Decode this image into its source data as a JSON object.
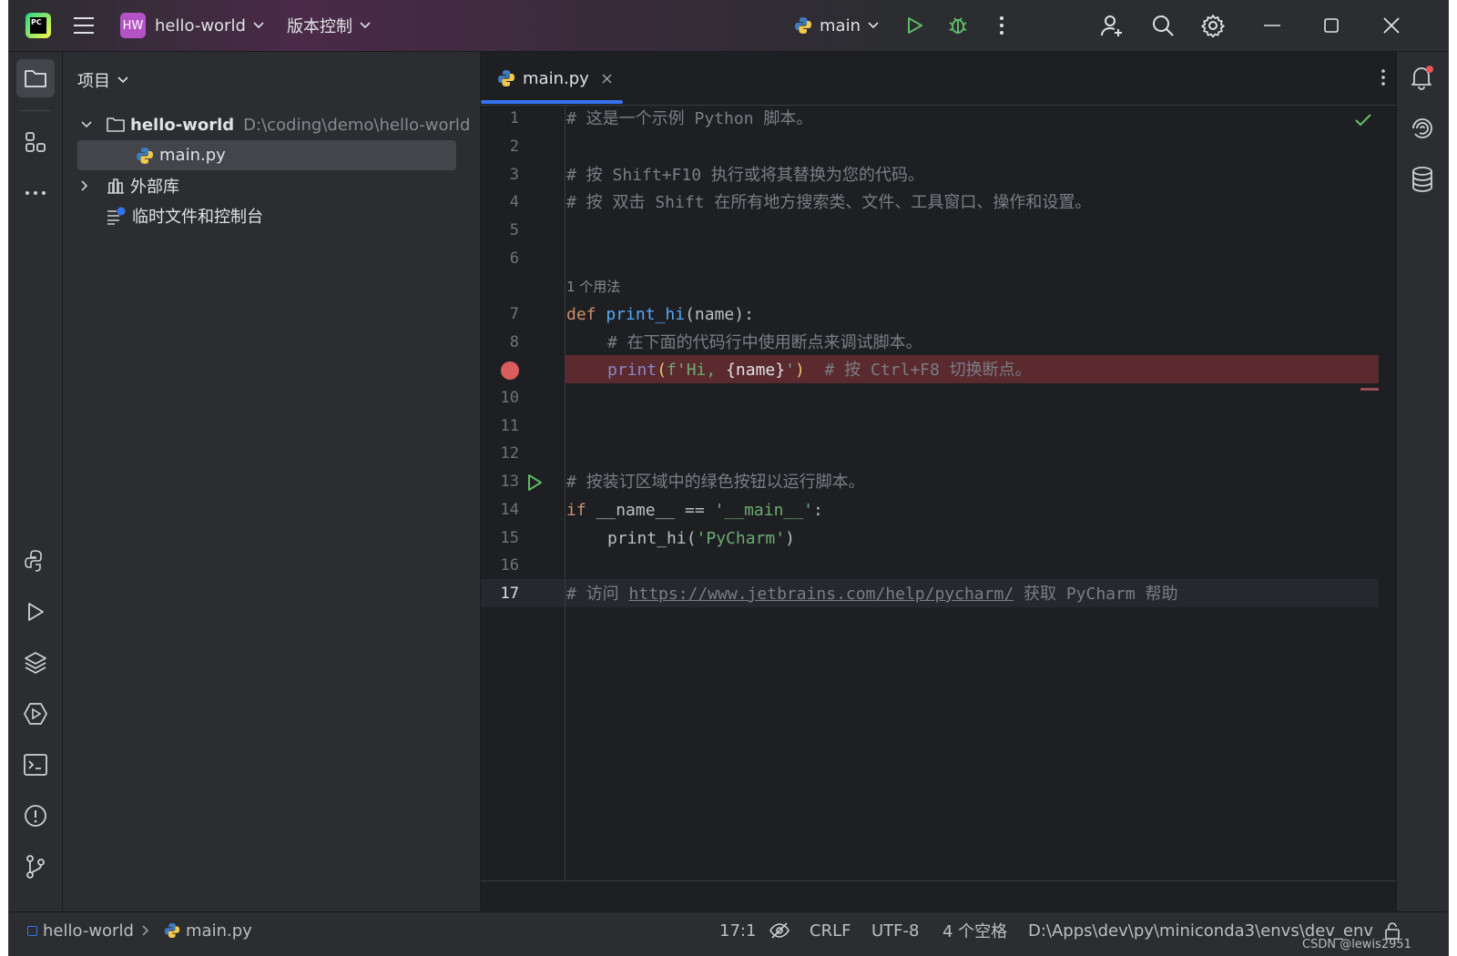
{
  "titlebar": {
    "logo_text": "PC",
    "project_badge": "HW",
    "project_name": "hello-world",
    "vcs_label": "版本控制",
    "run_config": "main"
  },
  "project_panel": {
    "title": "项目",
    "root_name": "hello-world",
    "root_path": "D:\\coding\\demo\\hello-world",
    "file_name": "main.py",
    "external_libs": "外部库",
    "scratches": "临时文件和控制台"
  },
  "editor": {
    "tab_label": "main.py",
    "usage_hint": "1 个用法",
    "lines": {
      "l1": "# 这是一个示例 Python 脚本。",
      "l3": "# 按 Shift+F10 执行或将其替换为您的代码。",
      "l4": "# 按 双击 Shift 在所有地方搜索类、文件、工具窗口、操作和设置。",
      "l7_kw": "def",
      "l7_fn": "print_hi",
      "l7_rest": "(name):",
      "l8": "# 在下面的代码行中使用断点来调试脚本。",
      "l9_print": "print",
      "l9_open": "(",
      "l9_str1": "f'Hi, ",
      "l9_name": "{name}",
      "l9_str2": "'",
      "l9_close": ")",
      "l9_comment": "# 按 Ctrl+F8 切换断点。",
      "l12": "# 按装订区域中的绿色按钮以运行脚本。",
      "l13_kw": "if",
      "l13_mid": " __name__ == ",
      "l13_str": "'__main__'",
      "l13_end": ":",
      "l14_call": "print_hi(",
      "l14_str": "'PyCharm'",
      "l14_end": ")",
      "l16_pre": "# 访问 ",
      "l16_link": "https://www.jetbrains.com/help/pycharm/",
      "l16_post": " 获取 PyCharm 帮助"
    },
    "line_numbers": [
      "1",
      "2",
      "3",
      "4",
      "5",
      "6",
      "7",
      "8",
      "10",
      "11",
      "12",
      "13",
      "14",
      "15",
      "16",
      "17"
    ]
  },
  "statusbar": {
    "crumb_project": "hello-world",
    "crumb_file": "main.py",
    "position": "17:1",
    "line_sep": "CRLF",
    "encoding": "UTF-8",
    "indent": "4 个空格",
    "interpreter": "D:\\Apps\\dev\\py\\miniconda3\\envs\\dev_env",
    "watermark": "CSDN @lewis2951"
  },
  "colors": {
    "background": "#1e1f22",
    "panel": "#2b2d30",
    "accent": "#3574f0",
    "keyword": "#cf8e6d",
    "function": "#56a8f5",
    "string": "#6aab73",
    "comment": "#7a7e85",
    "breakpoint": "#db5c5c",
    "run": "#5fb865"
  },
  "icons": [
    "pycharm-logo",
    "hamburger-menu-icon",
    "chevron-down-icon",
    "python-icon",
    "run-icon",
    "debug-icon",
    "more-vertical-icon",
    "add-user-icon",
    "search-icon",
    "settings-icon",
    "minimize-icon",
    "maximize-icon",
    "close-icon",
    "folder-icon",
    "structure-icon",
    "more-horizontal-icon",
    "python-console-icon",
    "run-tool-icon",
    "layers-icon",
    "services-icon",
    "terminal-icon",
    "problems-icon",
    "git-icon",
    "notifications-icon",
    "ai-assistant-icon",
    "database-icon",
    "breakpoint-icon",
    "check-icon",
    "lock-icon",
    "no-inspection-icon"
  ]
}
